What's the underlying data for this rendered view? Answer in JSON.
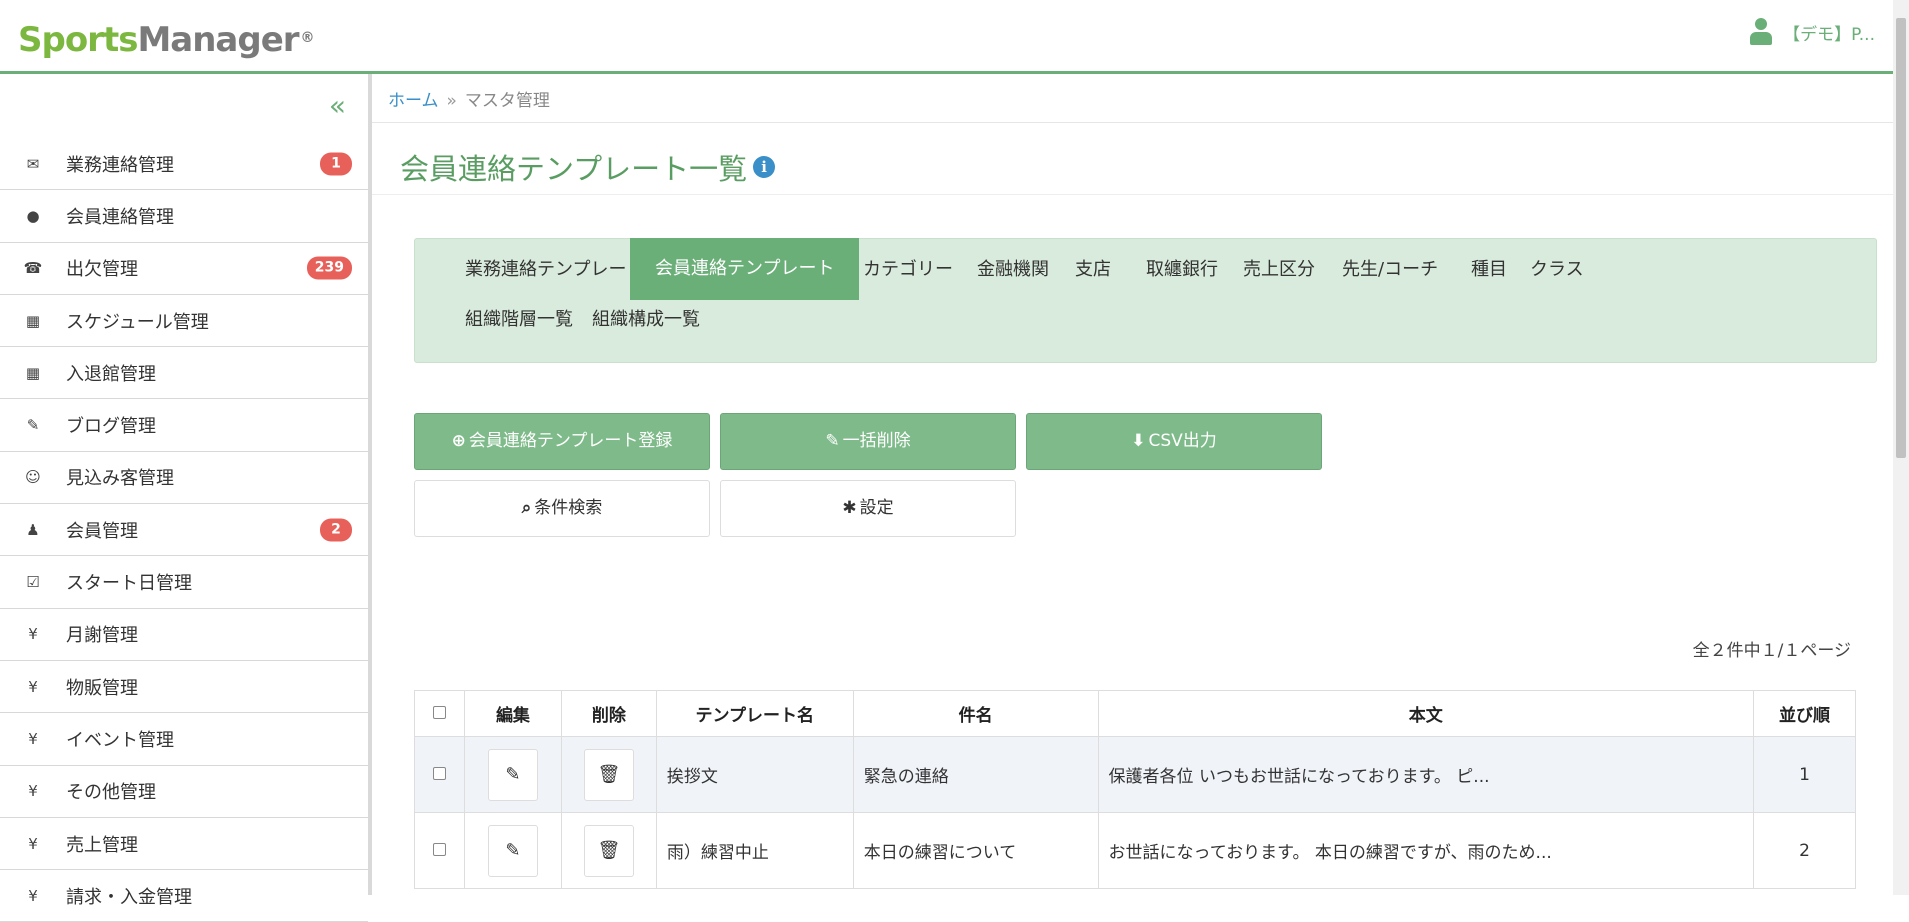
{
  "header": {
    "logo_part1": "Sports",
    "logo_part2": "Manager",
    "logo_mark": "®",
    "user_label": "【デモ】P..."
  },
  "sidebar": {
    "collapse_glyph": "«",
    "items": [
      {
        "icon": "envelope-icon",
        "glyph": "✉",
        "label": "業務連絡管理",
        "badge": "1"
      },
      {
        "icon": "comment-icon",
        "glyph": "●",
        "label": "会員連絡管理",
        "badge": ""
      },
      {
        "icon": "phone-icon",
        "glyph": "☎",
        "label": "出欠管理",
        "badge": "239"
      },
      {
        "icon": "calendar-icon",
        "glyph": "▦",
        "label": "スケジュール管理",
        "badge": ""
      },
      {
        "icon": "calendar-icon",
        "glyph": "▦",
        "label": "入退館管理",
        "badge": ""
      },
      {
        "icon": "pencil-icon",
        "glyph": "✎",
        "label": "ブログ管理",
        "badge": ""
      },
      {
        "icon": "smile-icon",
        "glyph": "☺",
        "label": "見込み客管理",
        "badge": ""
      },
      {
        "icon": "user-icon",
        "glyph": "♟",
        "label": "会員管理",
        "badge": "2"
      },
      {
        "icon": "check-square-icon",
        "glyph": "☑",
        "label": "スタート日管理",
        "badge": ""
      },
      {
        "icon": "yen-icon",
        "glyph": "¥",
        "label": "月謝管理",
        "badge": ""
      },
      {
        "icon": "yen-icon",
        "glyph": "¥",
        "label": "物販管理",
        "badge": ""
      },
      {
        "icon": "yen-icon",
        "glyph": "¥",
        "label": "イベント管理",
        "badge": ""
      },
      {
        "icon": "yen-icon",
        "glyph": "¥",
        "label": "その他管理",
        "badge": ""
      },
      {
        "icon": "yen-icon",
        "glyph": "¥",
        "label": "売上管理",
        "badge": ""
      },
      {
        "icon": "yen-icon",
        "glyph": "¥",
        "label": "請求・入金管理",
        "badge": ""
      }
    ]
  },
  "breadcrumb": {
    "home": "ホーム",
    "sep": "»",
    "current": "マスタ管理"
  },
  "page": {
    "title": "会員連絡テンプレート一覧",
    "info_glyph": "i"
  },
  "tabs": [
    {
      "label": "業務連絡テンプレート",
      "active": false
    },
    {
      "label": "会員連絡テンプレート",
      "active": true
    },
    {
      "label": "カテゴリー",
      "active": false
    },
    {
      "label": "金融機関",
      "active": false
    },
    {
      "label": "支店",
      "active": false
    },
    {
      "label": "取纏銀行",
      "active": false
    },
    {
      "label": "売上区分",
      "active": false
    },
    {
      "label": "先生/コーチ",
      "active": false
    },
    {
      "label": "種目",
      "active": false
    },
    {
      "label": "クラス",
      "active": false
    },
    {
      "label": "組織階層一覧",
      "active": false
    },
    {
      "label": "組織構成一覧",
      "active": false
    }
  ],
  "actions": {
    "register": {
      "icon": "plus-circle-icon",
      "glyph": "⊕",
      "label": "会員連絡テンプレート登録"
    },
    "bulk_delete": {
      "icon": "pencil-icon",
      "glyph": "✎",
      "label": "一括削除"
    },
    "csv": {
      "icon": "download-icon",
      "glyph": "⬇",
      "label": "CSV出力"
    },
    "search": {
      "icon": "search-icon",
      "glyph": "⌕",
      "label": "条件検索"
    },
    "settings": {
      "icon": "gear-icon",
      "glyph": "✱",
      "label": "設定"
    }
  },
  "pager": {
    "summary": "全２件中１/１ページ"
  },
  "table": {
    "headers": [
      "",
      "編集",
      "削除",
      "テンプレート名",
      "件名",
      "本文",
      "並び順"
    ],
    "rows": [
      {
        "name": "挨拶文",
        "subject": "緊急の連絡",
        "body": "保護者各位 いつもお世話になっております。 ピ...",
        "order": "1"
      },
      {
        "name": "雨）練習中止",
        "subject": "本日の練習について",
        "body": "お世話になっております。 本日の練習ですが、雨のため...",
        "order": "2"
      }
    ],
    "edit_glyph": "✎",
    "delete_glyph": "🗑"
  },
  "colors": {
    "accent": "#6aae78",
    "badge": "#e8605a",
    "link": "#3a8fc9",
    "tab_bg": "#d9ebdc"
  }
}
